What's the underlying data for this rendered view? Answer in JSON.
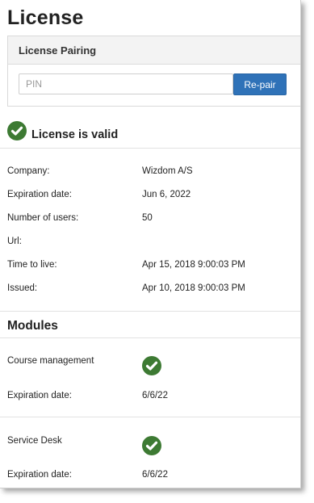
{
  "page": {
    "title": "License"
  },
  "pairing": {
    "title": "License Pairing",
    "pin_placeholder": "PIN",
    "pin_value": "",
    "repair_label": "Re-pair"
  },
  "status": {
    "text": "License is valid",
    "icon": "check-circle-icon"
  },
  "details": [
    {
      "label": "Company:",
      "value": "Wizdom A/S"
    },
    {
      "label": "Expiration date:",
      "value": "Jun 6, 2022"
    },
    {
      "label": "Number of users:",
      "value": "50"
    },
    {
      "label": "Url:",
      "value": ""
    },
    {
      "label": "Time to live:",
      "value": "Apr 15, 2018 9:00:03 PM"
    },
    {
      "label": "Issued:",
      "value": "Apr 10, 2018 9:00:03 PM"
    }
  ],
  "modules": {
    "title": "Modules",
    "items": [
      {
        "name": "Course management",
        "status_icon": "check-circle-icon",
        "expiration_label": "Expiration date:",
        "expiration_value": "6/6/22"
      },
      {
        "name": "Service Desk",
        "status_icon": "check-circle-icon",
        "expiration_label": "Expiration date:",
        "expiration_value": "6/6/22"
      }
    ]
  },
  "colors": {
    "accent_button": "#2f72b8",
    "valid_check": "#3d7a33"
  }
}
